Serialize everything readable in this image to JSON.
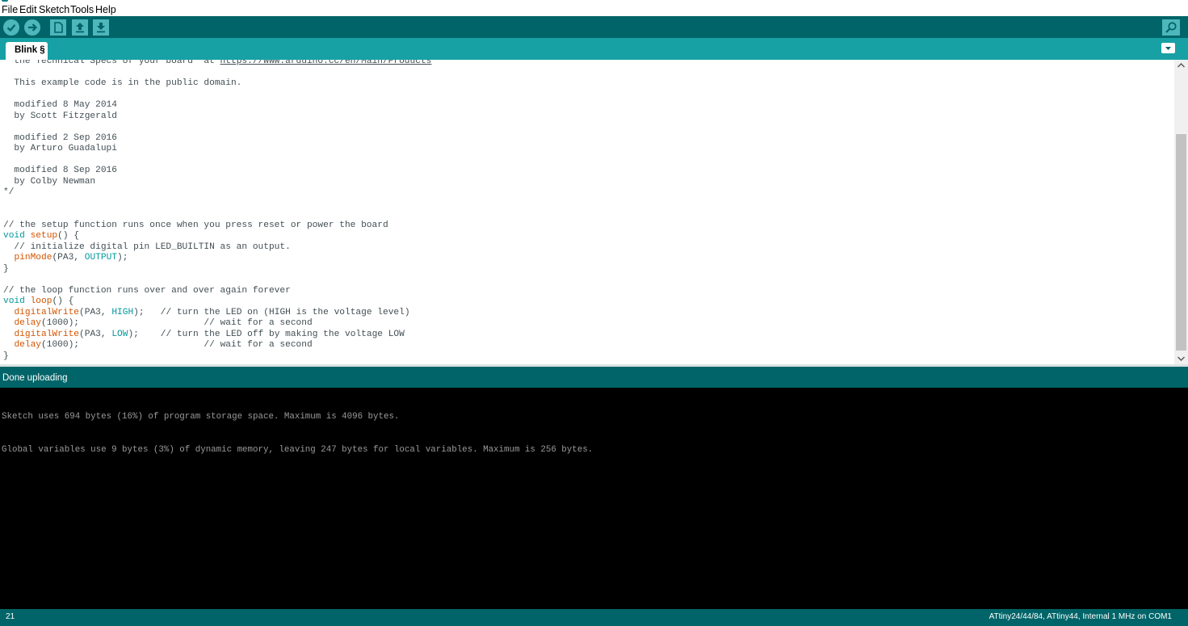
{
  "menu": [
    "File",
    "Edit",
    "Sketch",
    "Tools",
    "Help"
  ],
  "toolbar": {
    "buttons": [
      {
        "name": "verify-button",
        "icon": "check-icon"
      },
      {
        "name": "upload-button",
        "icon": "arrow-right-icon"
      },
      {
        "name": "new-button",
        "icon": "new-file-icon"
      },
      {
        "name": "open-button",
        "icon": "arrow-up-icon"
      },
      {
        "name": "save-button",
        "icon": "arrow-down-icon"
      }
    ],
    "serial_monitor_icon": "magnifier-icon"
  },
  "tab": {
    "label": "Blink §",
    "menu_icon": "chevron-down-icon"
  },
  "editor": {
    "lines": [
      {
        "segments": [
          {
            "t": "  the Technical Specs of your board  at ",
            "c": "plain"
          },
          {
            "t": "https://www.arduino.cc/en/Main/Products",
            "c": "url"
          }
        ]
      },
      {
        "segments": [
          {
            "t": "",
            "c": "plain"
          }
        ]
      },
      {
        "segments": [
          {
            "t": "  This example code is in the public domain.",
            "c": "plain"
          }
        ]
      },
      {
        "segments": [
          {
            "t": "",
            "c": "plain"
          }
        ]
      },
      {
        "segments": [
          {
            "t": "  modified 8 May 2014",
            "c": "plain"
          }
        ]
      },
      {
        "segments": [
          {
            "t": "  by Scott Fitzgerald",
            "c": "plain"
          }
        ]
      },
      {
        "segments": [
          {
            "t": "",
            "c": "plain"
          }
        ]
      },
      {
        "segments": [
          {
            "t": "  modified 2 Sep 2016",
            "c": "plain"
          }
        ]
      },
      {
        "segments": [
          {
            "t": "  by Arturo Guadalupi",
            "c": "plain"
          }
        ]
      },
      {
        "segments": [
          {
            "t": "",
            "c": "plain"
          }
        ]
      },
      {
        "segments": [
          {
            "t": "  modified 8 Sep 2016",
            "c": "plain"
          }
        ]
      },
      {
        "segments": [
          {
            "t": "  by Colby Newman",
            "c": "plain"
          }
        ]
      },
      {
        "segments": [
          {
            "t": "*/",
            "c": "plain"
          }
        ]
      },
      {
        "segments": [
          {
            "t": "",
            "c": "plain"
          }
        ]
      },
      {
        "segments": [
          {
            "t": "",
            "c": "plain"
          }
        ]
      },
      {
        "segments": [
          {
            "t": "// the setup function runs once when you press reset or power the board",
            "c": "plain"
          }
        ]
      },
      {
        "segments": [
          {
            "t": "void",
            "c": "kw"
          },
          {
            "t": " ",
            "c": "plain"
          },
          {
            "t": "setup",
            "c": "fn"
          },
          {
            "t": "() {",
            "c": "plain"
          }
        ]
      },
      {
        "segments": [
          {
            "t": "  // initialize digital pin LED_BUILTIN as an output.",
            "c": "plain"
          }
        ]
      },
      {
        "segments": [
          {
            "t": "  ",
            "c": "plain"
          },
          {
            "t": "pinMode",
            "c": "fn"
          },
          {
            "t": "(PA3, ",
            "c": "plain"
          },
          {
            "t": "OUTPUT",
            "c": "cst"
          },
          {
            "t": ");",
            "c": "plain"
          }
        ]
      },
      {
        "segments": [
          {
            "t": "}",
            "c": "plain"
          }
        ]
      },
      {
        "segments": [
          {
            "t": "",
            "c": "plain"
          }
        ]
      },
      {
        "segments": [
          {
            "t": "// the loop function runs over and over again forever",
            "c": "plain"
          }
        ]
      },
      {
        "segments": [
          {
            "t": "void",
            "c": "kw"
          },
          {
            "t": " ",
            "c": "plain"
          },
          {
            "t": "loop",
            "c": "fn"
          },
          {
            "t": "() {",
            "c": "plain"
          }
        ]
      },
      {
        "segments": [
          {
            "t": "  ",
            "c": "plain"
          },
          {
            "t": "digitalWrite",
            "c": "fn"
          },
          {
            "t": "(PA3, ",
            "c": "plain"
          },
          {
            "t": "HIGH",
            "c": "cst"
          },
          {
            "t": ");   // turn the LED on (HIGH is the voltage level)",
            "c": "plain"
          }
        ]
      },
      {
        "segments": [
          {
            "t": "  ",
            "c": "plain"
          },
          {
            "t": "delay",
            "c": "fn"
          },
          {
            "t": "(1000);                       // wait for a second",
            "c": "plain"
          }
        ]
      },
      {
        "segments": [
          {
            "t": "  ",
            "c": "plain"
          },
          {
            "t": "digitalWrite",
            "c": "fn"
          },
          {
            "t": "(PA3, ",
            "c": "plain"
          },
          {
            "t": "LOW",
            "c": "cst"
          },
          {
            "t": ");    // turn the LED off by making the voltage LOW",
            "c": "plain"
          }
        ]
      },
      {
        "segments": [
          {
            "t": "  ",
            "c": "plain"
          },
          {
            "t": "delay",
            "c": "fn"
          },
          {
            "t": "(1000);                       // wait for a second",
            "c": "plain"
          }
        ]
      },
      {
        "segments": [
          {
            "t": "}",
            "c": "plain"
          }
        ]
      }
    ]
  },
  "status": {
    "message": "Done uploading"
  },
  "console": {
    "lines": [
      "Sketch uses 694 bytes (16%) of program storage space. Maximum is 4096 bytes.",
      "Global variables use 9 bytes (3%) of dynamic memory, leaving 247 bytes for local variables. Maximum is 256 bytes."
    ]
  },
  "footer": {
    "line_number": "21",
    "board_info": "ATtiny24/44/84, ATtiny44, Internal 1 MHz on COM1"
  },
  "colors": {
    "toolbar_bg": "#006468",
    "tab_strip_bg": "#17a1a5",
    "keyword": "#00979c",
    "function": "#d35400",
    "console_bg": "#000000"
  }
}
